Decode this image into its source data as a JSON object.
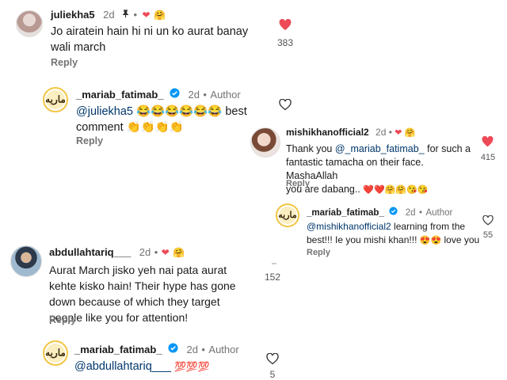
{
  "comments": [
    {
      "username": "juliekha5",
      "time": "2d",
      "text": "Jo airatein hain hi ni un ko aurat banay wali march",
      "reply_label": "Reply",
      "likes": "383"
    },
    {
      "username": "_mariab_fatimab_",
      "time": "2d",
      "author_label": "Author",
      "mention": "@juliekha5",
      "emoji": "😂😂😂😂😂😂",
      "text_tail": "best",
      "text_line2": "comment",
      "emoji2": "👏👏👏👏",
      "reply_label": "Reply"
    },
    {
      "username": "mishikhanofficial2",
      "time": "2d",
      "text_pre": "Thank you",
      "mention": "@_mariab_fatimab_",
      "text_post": "for such a",
      "text_line2": "fantastic tamacha on their face. MashaAllah",
      "text_line3": "you are dabang..",
      "emoji": "❤️❤️🤗🤗😘😘",
      "reply_label": "Reply",
      "likes": "415"
    },
    {
      "username": "_mariab_fatimab_",
      "time": "2d",
      "author_label": "Author",
      "mention": "@mishikhanofficial2",
      "text_post": "learning from the",
      "text_line2": "best!!! Ie you mishi khan!!!",
      "emoji": "😍😍",
      "text_tail": "love you",
      "reply_label": "Reply",
      "likes": "55"
    },
    {
      "username": "abdullahtariq___",
      "time": "2d",
      "text": "Aurat March jisko yeh nai pata aurat kehte kisko hain! Their hype has gone down because of which they target people like you for attention!",
      "reply_label": "Reply",
      "likes": "152"
    },
    {
      "username": "_mariab_fatimab_",
      "time": "2d",
      "author_label": "Author",
      "mention": "@abdullahtariq___",
      "emoji": "💯💯💯",
      "likes": "5"
    }
  ],
  "colors": {
    "heart_red": "#ed4956",
    "mention_blue": "#00376b",
    "verified_blue": "#0095f6",
    "meta_gray": "#737373"
  },
  "icons": [
    "heart-filled-icon",
    "heart-outline-icon",
    "pin-icon",
    "verified-icon"
  ]
}
